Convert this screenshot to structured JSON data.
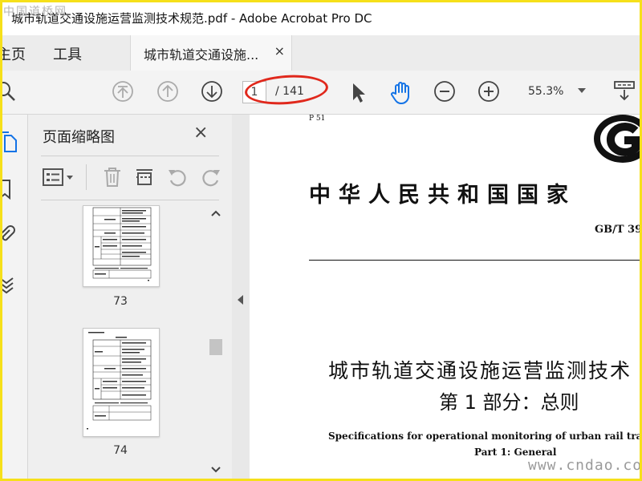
{
  "window": {
    "title": "城市轨道交通设施运营监测技术规范.pdf - Adobe Acrobat Pro DC"
  },
  "menu": {
    "home": "主页",
    "tools": "工具"
  },
  "tab": {
    "label": "城市轨道交通设施...",
    "close": "×"
  },
  "toolbar": {
    "page_current": "1",
    "page_total": "/ 141",
    "zoom": "55.3%"
  },
  "panel": {
    "title": "页面缩略图",
    "close": "×",
    "thumbnails": [
      {
        "page": "73"
      },
      {
        "page": "74"
      }
    ]
  },
  "document": {
    "page_code": "P 51",
    "national_title": "中华人民共和国国家",
    "standard_no": "GB/T 39",
    "title_zh": "城市轨道交通设施运营监测技术",
    "subtitle_zh": "第 1 部分：总则",
    "title_en": "Specifications for operational monitoring of urban rail transit",
    "subtitle_en": "Part 1: General"
  },
  "watermarks": {
    "left": "中国道桥网",
    "right": "www.cndao.com"
  },
  "colors": {
    "frame": "#f6e01a",
    "annotation_circle": "#e0281c",
    "hand_tool": "#1473e6"
  }
}
